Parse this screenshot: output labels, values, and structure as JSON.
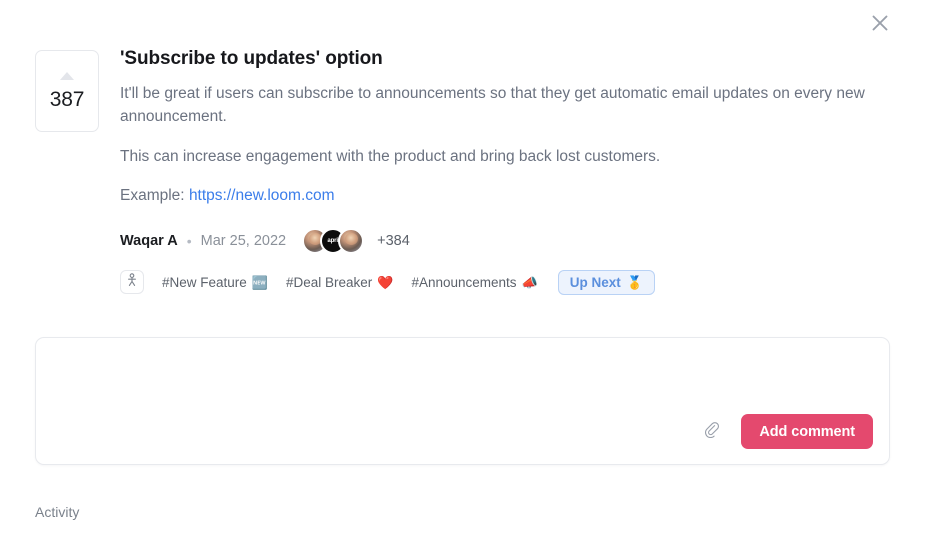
{
  "window": {
    "close_icon": "close-icon"
  },
  "post": {
    "vote_count": "387",
    "vote_caret_icon": "caret-up-icon",
    "title": "'Subscribe to updates' option",
    "paragraphs": [
      "It'll be great if users can subscribe to announcements so that they get automatic email updates on every new announcement.",
      "This can increase engagement with the product and bring back lost customers."
    ],
    "example_label": "Example:",
    "example_link": "https://new.loom.com",
    "meta": {
      "author": "Waqar A",
      "separator": "•",
      "date": "Mar 25, 2022",
      "avatars": [
        {
          "type": "photo",
          "label": ""
        },
        {
          "type": "logo",
          "label": "april"
        },
        {
          "type": "photo",
          "label": ""
        }
      ],
      "more_count": "+384"
    },
    "tags_icon": "person-pin-icon",
    "tags": [
      {
        "label": "#New Feature",
        "emoji": "🆕"
      },
      {
        "label": "#Deal Breaker",
        "emoji": "❤️"
      },
      {
        "label": "#Announcements",
        "emoji": "📣"
      }
    ],
    "status": {
      "label": "Up Next",
      "emoji": "🥇"
    }
  },
  "composer": {
    "placeholder": "",
    "value": "",
    "attach_icon": "paperclip-icon",
    "submit_label": "Add comment"
  },
  "activity": {
    "label": "Activity"
  },
  "colors": {
    "accent_pink": "#e4496e",
    "link_blue": "#3b7dea",
    "status_blue": "#5b8fdd",
    "status_bg": "#edf3fd",
    "text_dark": "#17181c",
    "text_muted": "#6b7280"
  }
}
